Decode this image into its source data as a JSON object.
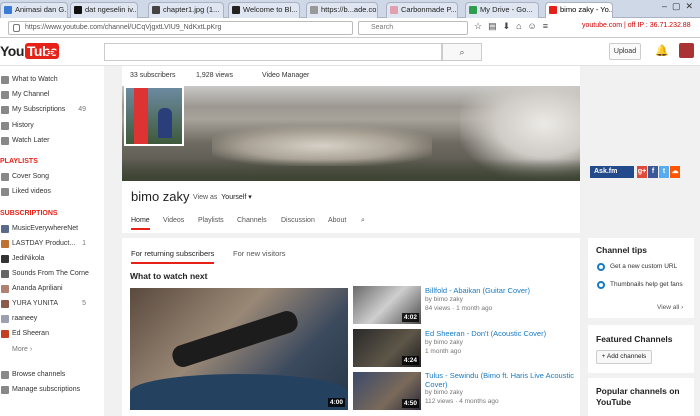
{
  "browser": {
    "tabs": [
      {
        "label": "Animasi dan G...",
        "color": "#3a7bd5"
      },
      {
        "label": "dat ngeselin iv...",
        "color": "#111111"
      },
      {
        "label": "chapter1.jpg (1...",
        "color": "#444444"
      },
      {
        "label": "Welcome to Bl...",
        "color": "#222222"
      },
      {
        "label": "https://b...ade.com/",
        "color": "#999999"
      },
      {
        "label": "Carbonmade P...",
        "color": "#e0a0b0"
      },
      {
        "label": "My Drive - Go...",
        "color": "#2e9e4e"
      },
      {
        "label": "bimo zaky - Yo...",
        "color": "#e62117"
      }
    ],
    "url": "https://www.youtube.com/channel/UCqVjgxtLVIU9_NdKxtLpKrg",
    "search_placeholder": "Search",
    "ip_text": "youtube.com | off  IP : 36.71.232.88"
  },
  "header": {
    "logo_text": "You",
    "logo_tube": "Tube",
    "upload_label": "Upload",
    "search_button": "⌕"
  },
  "sidebar": {
    "items": [
      {
        "label": "What to Watch",
        "icon": "home-icon"
      },
      {
        "label": "My Channel",
        "icon": "person-icon"
      },
      {
        "label": "My Subscriptions",
        "icon": "subscriptions-icon",
        "count": "49"
      },
      {
        "label": "History",
        "icon": "history-icon"
      },
      {
        "label": "Watch Later",
        "icon": "clock-icon"
      }
    ],
    "playlists_heading": "PLAYLISTS",
    "playlists": [
      {
        "label": "Cover Song"
      },
      {
        "label": "Liked videos"
      }
    ],
    "subscriptions_heading": "SUBSCRIPTIONS",
    "subscriptions": [
      {
        "label": "MusicEverywhereNet",
        "color": "#5a6a8a"
      },
      {
        "label": "LASTDAY Product...",
        "color": "#c07030",
        "count": "1"
      },
      {
        "label": "JediNikola",
        "color": "#333333"
      },
      {
        "label": "Sounds From The Corne",
        "color": "#666666"
      },
      {
        "label": "Ananda Apriliani",
        "color": "#b08070"
      },
      {
        "label": "YURA YUNITA",
        "color": "#8a5a4a",
        "count": "5"
      },
      {
        "label": "raaneey",
        "color": "#9aa0b0"
      },
      {
        "label": "Ed Sheeran",
        "color": "#c04020"
      }
    ],
    "more_label": "More ›",
    "browse_label": "Browse channels",
    "manage_label": "Manage subscriptions"
  },
  "channel": {
    "subscribers": "33 subscribers",
    "views": "1,928 views",
    "video_manager": "Video Manager",
    "name": "bimo zaky",
    "view_as_label": "View as",
    "view_as_value": "Yourself ▾",
    "askfm": "Ask.fm",
    "nav_tabs": [
      "Home",
      "Videos",
      "Playlists",
      "Channels",
      "Discussion",
      "About"
    ],
    "section_tabs": [
      "For returning subscribers",
      "For new visitors"
    ],
    "section_heading": "What to watch next"
  },
  "videos": {
    "featured_duration": "4:00",
    "list": [
      {
        "title": "Billfold - Abaikan (Guitar Cover)",
        "by": "by bimo zaky",
        "views": "84 views",
        "age": "1 month ago",
        "duration": "4:02"
      },
      {
        "title": "Ed Sheeran - Don't (Acoustic Cover)",
        "by": "by bimo zaky",
        "views": "",
        "age": "1 month ago",
        "duration": "4:24"
      },
      {
        "title": "Tulus - Sewindu (Bimo ft. Haris Live Acoustic Cover)",
        "by": "by bimo zaky",
        "views": "112 views",
        "age": "4 months ago",
        "duration": "4:50"
      }
    ]
  },
  "right_panel": {
    "tips_title": "Channel tips",
    "tips": [
      "Get a new custom URL",
      "Thumbnails help get fans"
    ],
    "view_all": "View all ›",
    "featured_title": "Featured Channels",
    "add_channels": "+ Add channels",
    "popular_title": "Popular channels on YouTube"
  }
}
